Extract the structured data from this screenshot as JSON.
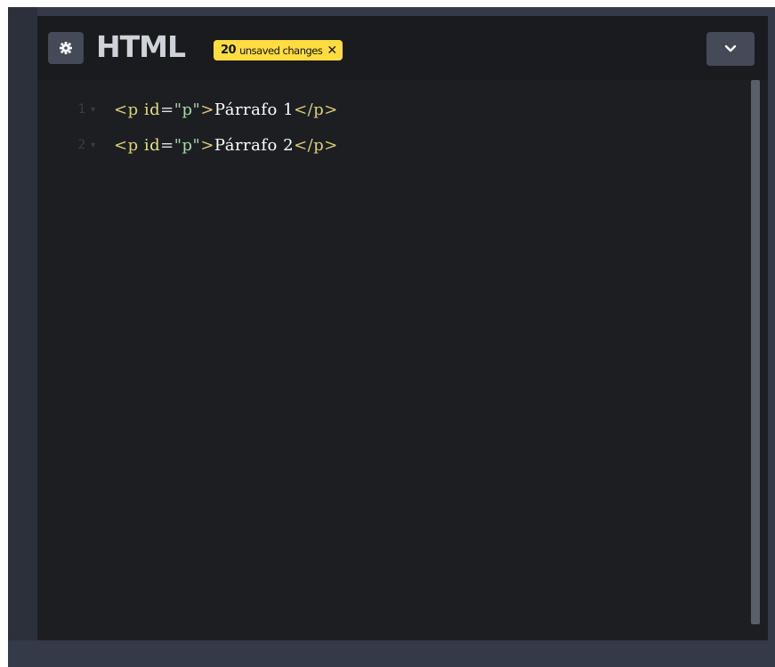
{
  "header": {
    "title": "HTML",
    "badge_count": "20",
    "badge_text": "unsaved changes",
    "badge_close": "✕"
  },
  "editor": {
    "lines": [
      {
        "number": "1",
        "fold": "▾",
        "tag_open": "<p",
        "attr": "id",
        "eq": "=",
        "value": "\"p\"",
        "close_bracket": ">",
        "text": "Párrafo 1",
        "tag_close": "</p>"
      },
      {
        "number": "2",
        "fold": "▾",
        "tag_open": "<p",
        "attr": "id",
        "eq": "=",
        "value": "\"p\"",
        "close_bracket": ">",
        "text": "Párrafo 2",
        "tag_close": "</p>"
      }
    ]
  },
  "icons": {
    "settings": "gear-icon",
    "collapse": "chevron-down-icon",
    "close": "close-icon"
  },
  "colors": {
    "badge": "#ffdd40",
    "editor_bg": "#1d1e22",
    "header_bg": "#1a1b1e",
    "tag": "#dcd17a",
    "string": "#a8d8a8"
  }
}
